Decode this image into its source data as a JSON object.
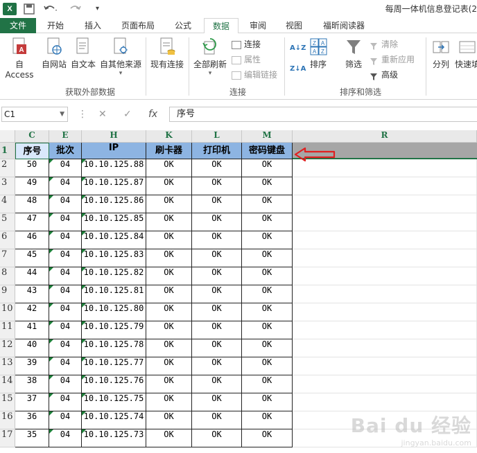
{
  "window": {
    "title": "每周一体机信息登记表(2",
    "app_logo": "X"
  },
  "quick_access": {
    "save_icon": "save-icon",
    "undo_icon": "undo-icon",
    "redo_icon": "redo-icon"
  },
  "tabs": [
    {
      "label": "文件"
    },
    {
      "label": "开始"
    },
    {
      "label": "插入"
    },
    {
      "label": "页面布局"
    },
    {
      "label": "公式"
    },
    {
      "label": "数据"
    },
    {
      "label": "审阅"
    },
    {
      "label": "视图"
    },
    {
      "label": "福昕阅读器"
    }
  ],
  "ribbon": {
    "from_access": "自 Access",
    "from_web": "自网站",
    "from_text": "自文本",
    "from_other": "自其他来源",
    "existing_connections": "现有连接",
    "refresh_all": "全部刷新",
    "connections": "连接",
    "properties": "属性",
    "edit_links": "编辑链接",
    "sort_az": "A↓Z",
    "sort_za": "Z↓A",
    "sort": "排序",
    "filter": "筛选",
    "clear": "清除",
    "reapply": "重新应用",
    "advanced": "高级",
    "text_to_columns": "分列",
    "flash_fill": "快速填",
    "group_external": "获取外部数据",
    "group_connections": "连接",
    "group_sort_filter": "排序和筛选"
  },
  "formula_bar": {
    "name_box": "C1",
    "fx": "fx",
    "content": "序号"
  },
  "columns": [
    "C",
    "E",
    "H",
    "K",
    "L",
    "M",
    "R"
  ],
  "header_row": [
    "序号",
    "批次",
    "IP",
    "刷卡器",
    "打印机",
    "密码键盘"
  ],
  "rows": [
    {
      "n": "2",
      "c": [
        "50",
        "04",
        "10.10.125.88",
        "OK",
        "OK",
        "OK"
      ]
    },
    {
      "n": "3",
      "c": [
        "49",
        "04",
        "10.10.125.87",
        "OK",
        "OK",
        "OK"
      ]
    },
    {
      "n": "4",
      "c": [
        "48",
        "04",
        "10.10.125.86",
        "OK",
        "OK",
        "OK"
      ]
    },
    {
      "n": "5",
      "c": [
        "47",
        "04",
        "10.10.125.85",
        "OK",
        "OK",
        "OK"
      ]
    },
    {
      "n": "6",
      "c": [
        "46",
        "04",
        "10.10.125.84",
        "OK",
        "OK",
        "OK"
      ]
    },
    {
      "n": "7",
      "c": [
        "45",
        "04",
        "10.10.125.83",
        "OK",
        "OK",
        "OK"
      ]
    },
    {
      "n": "8",
      "c": [
        "44",
        "04",
        "10.10.125.82",
        "OK",
        "OK",
        "OK"
      ]
    },
    {
      "n": "9",
      "c": [
        "43",
        "04",
        "10.10.125.81",
        "OK",
        "OK",
        "OK"
      ]
    },
    {
      "n": "10",
      "c": [
        "42",
        "04",
        "10.10.125.80",
        "OK",
        "OK",
        "OK"
      ]
    },
    {
      "n": "11",
      "c": [
        "41",
        "04",
        "10.10.125.79",
        "OK",
        "OK",
        "OK"
      ]
    },
    {
      "n": "12",
      "c": [
        "40",
        "04",
        "10.10.125.78",
        "OK",
        "OK",
        "OK"
      ]
    },
    {
      "n": "13",
      "c": [
        "39",
        "04",
        "10.10.125.77",
        "OK",
        "OK",
        "OK"
      ]
    },
    {
      "n": "14",
      "c": [
        "38",
        "04",
        "10.10.125.76",
        "OK",
        "OK",
        "OK"
      ]
    },
    {
      "n": "15",
      "c": [
        "37",
        "04",
        "10.10.125.75",
        "OK",
        "OK",
        "OK"
      ]
    },
    {
      "n": "16",
      "c": [
        "36",
        "04",
        "10.10.125.74",
        "OK",
        "OK",
        "OK"
      ]
    },
    {
      "n": "17",
      "c": [
        "35",
        "04",
        "10.10.125.73",
        "OK",
        "OK",
        "OK"
      ]
    }
  ],
  "header_row_number": "1",
  "colors": {
    "excel_green": "#217346",
    "header_fill": "#8db4e2",
    "annotation_red": "#e02020"
  },
  "watermark": {
    "main": "Bai du 经验",
    "sub": "jingyan.baidu.com"
  }
}
